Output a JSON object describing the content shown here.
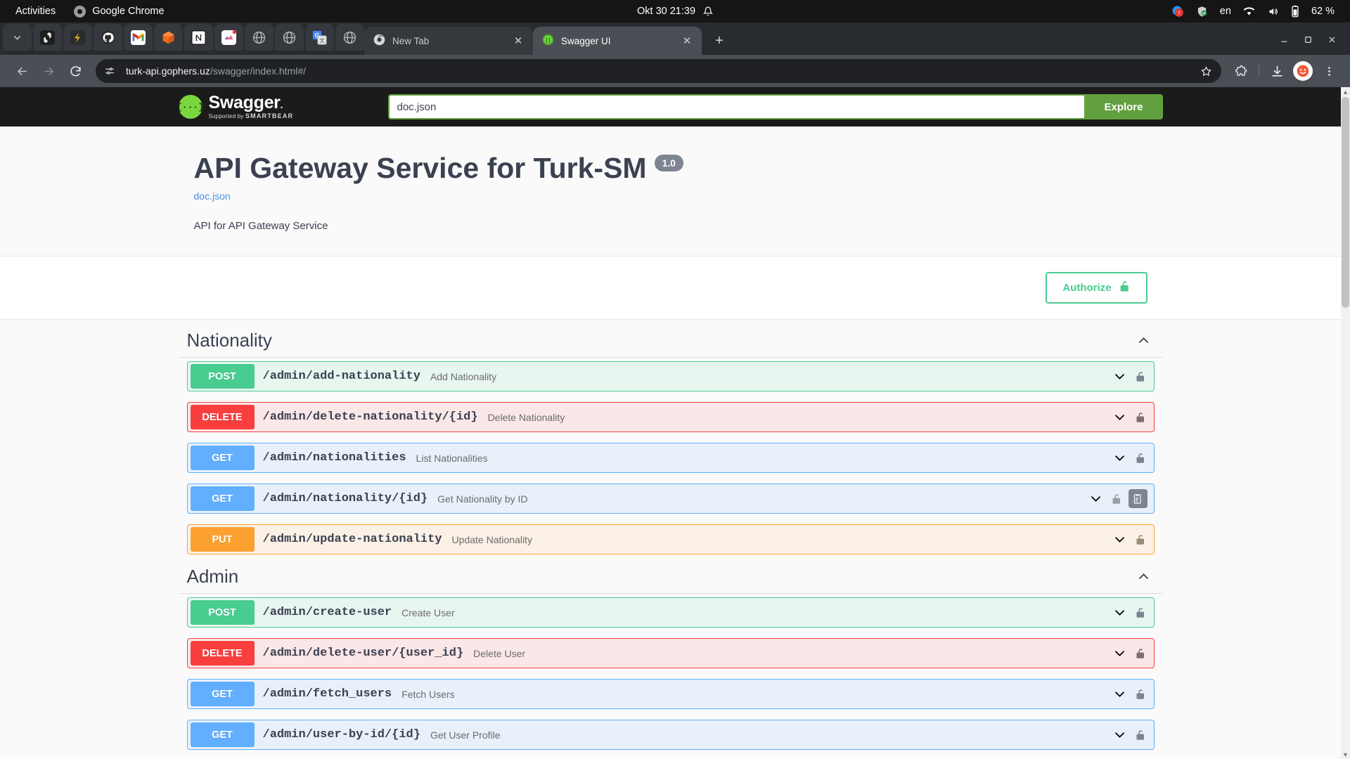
{
  "os_bar": {
    "activities": "Activities",
    "app_name": "Google Chrome",
    "clock": "Okt 30  21:39",
    "language": "en",
    "battery": "62 %",
    "icons": {
      "app": "chrome-icon",
      "bell": "bell-icon",
      "notification": "notification-badge-icon",
      "shield": "shield-check-icon",
      "wifi": "wifi-icon",
      "volume": "volume-icon",
      "battery": "battery-icon"
    }
  },
  "browser": {
    "pinned_tabs": [
      {
        "name": "tab-list-chevron",
        "icon": "chevron-down-icon"
      },
      {
        "name": "pinned-openai",
        "icon": "openai-icon"
      },
      {
        "name": "pinned-grok",
        "icon": "grok-icon"
      },
      {
        "name": "pinned-github",
        "icon": "github-icon"
      },
      {
        "name": "pinned-gmail",
        "icon": "gmail-icon"
      },
      {
        "name": "pinned-cube",
        "icon": "cube-icon"
      },
      {
        "name": "pinned-notion",
        "icon": "notion-icon"
      },
      {
        "name": "pinned-clickup",
        "icon": "clickup-icon"
      },
      {
        "name": "pinned-globe-1",
        "icon": "globe-icon"
      },
      {
        "name": "pinned-globe-2",
        "icon": "globe-icon"
      },
      {
        "name": "pinned-translate",
        "icon": "google-translate-icon"
      },
      {
        "name": "pinned-globe-3",
        "icon": "globe-icon"
      }
    ],
    "tabs": [
      {
        "title": "New Tab",
        "active": false,
        "favicon": "chrome-icon"
      },
      {
        "title": "Swagger UI",
        "active": true,
        "favicon": "swagger-icon"
      }
    ],
    "new_tab_label": "+",
    "close_label": "✕",
    "url_domain": "turk-api.gophers.uz",
    "url_path": "/swagger/index.html#/",
    "window_controls": {
      "minimize": "—",
      "maximize": "□",
      "close": "✕"
    },
    "toolbar_icons": {
      "back": "back-arrow-icon",
      "forward": "forward-arrow-icon",
      "reload": "reload-icon",
      "site_info": "site-settings-icon",
      "bookmark": "star-icon",
      "extensions": "puzzle-piece-icon",
      "downloads": "download-icon",
      "profile": "profile-avatar-icon",
      "menu": "kebab-menu-icon"
    }
  },
  "swagger": {
    "logo_text": "Swagger",
    "logo_dot": ".",
    "logo_supported": "Supported by",
    "logo_brand": "SMARTBEAR",
    "logo_mark": "{···}",
    "url_input_value": "doc.json",
    "url_input_placeholder": "doc.json",
    "explore_label": "Explore",
    "title": "API Gateway Service for Turk-SM",
    "version": "1.0",
    "doc_link": "doc.json",
    "description": "API for API Gateway Service",
    "authorize_label": "Authorize",
    "authorize_icon": "unlocked-padlock-icon",
    "colors": {
      "green": "#49cc90",
      "explore_green": "#62a03f",
      "logo_green": "#7ad63f",
      "get_blue": "#61affe",
      "post_green": "#49cc90",
      "delete_red": "#f93e3e",
      "put_orange": "#fca130",
      "text": "#3b4151",
      "version_badge": "#7d8492",
      "link_blue": "#4a90e2"
    },
    "sections": [
      {
        "name": "Nationality",
        "collapse_icon": "chevron-up-icon",
        "operations": [
          {
            "verb": "POST",
            "type": "post",
            "path": "/admin/add-nationality",
            "summary": "Add Nationality",
            "locked": true,
            "copy": false
          },
          {
            "verb": "DELETE",
            "type": "del",
            "path": "/admin/delete-nationality/{id}",
            "summary": "Delete Nationality",
            "locked": true,
            "copy": false
          },
          {
            "verb": "GET",
            "type": "get",
            "path": "/admin/nationalities",
            "summary": "List Nationalities",
            "locked": true,
            "copy": false
          },
          {
            "verb": "GET",
            "type": "get",
            "path": "/admin/nationality/{id}",
            "summary": "Get Nationality by ID",
            "locked": true,
            "copy": true
          },
          {
            "verb": "PUT",
            "type": "put",
            "path": "/admin/update-nationality",
            "summary": "Update Nationality",
            "locked": true,
            "copy": false
          }
        ]
      },
      {
        "name": "Admin",
        "collapse_icon": "chevron-up-icon",
        "operations": [
          {
            "verb": "POST",
            "type": "post",
            "path": "/admin/create-user",
            "summary": "Create User",
            "locked": true,
            "copy": false
          },
          {
            "verb": "DELETE",
            "type": "del",
            "path": "/admin/delete-user/{user_id}",
            "summary": "Delete User",
            "locked": true,
            "copy": false
          },
          {
            "verb": "GET",
            "type": "get",
            "path": "/admin/fetch_users",
            "summary": "Fetch Users",
            "locked": true,
            "copy": false
          },
          {
            "verb": "GET",
            "type": "get",
            "path": "/admin/user-by-id/{id}",
            "summary": "Get User Profile",
            "locked": true,
            "copy": false
          }
        ]
      }
    ]
  }
}
